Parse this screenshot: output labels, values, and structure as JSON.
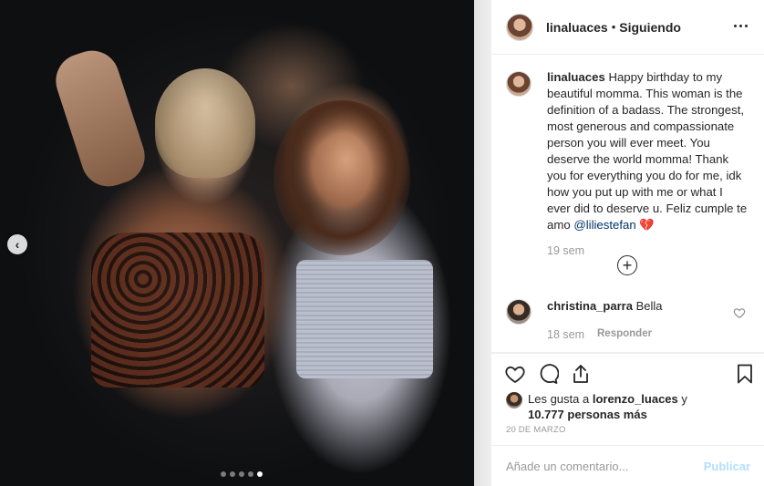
{
  "post": {
    "author": "linaluaces",
    "follow_status": "Siguiendo",
    "separator": "•",
    "caption_user": "linaluaces",
    "caption_text": "Happy birthday to my beautiful momma. This woman is the definition of a badass. The strongest, most generous and compassionate person you will ever meet. You deserve the world momma! Thank you for everything you do for me, idk how you put up with me or what I ever did to deserve u. Feliz cumple te amo ",
    "caption_mention": "@liliestefan",
    "caption_emoji": "💔",
    "caption_time": "19 sem",
    "load_more_symbol": "+"
  },
  "comment": {
    "user": "christina_parra",
    "text": "Bella",
    "time": "18 sem",
    "reply_label": "Responder"
  },
  "likes": {
    "prefix": "Les gusta a",
    "user": "lorenzo_luaces",
    "middle": "y",
    "count": "10.777 personas más"
  },
  "date": "20 DE MARZO",
  "comment_input": {
    "placeholder": "Añade un comentario...",
    "publish_label": "Publicar"
  },
  "carousel": {
    "total_slides": 5,
    "active_index": 4,
    "prev_symbol": "‹"
  },
  "colors": {
    "text": "#262626",
    "muted": "#999999",
    "mention": "#003569",
    "publish_disabled": "#b2dffc",
    "border": "#efefef"
  },
  "icons": [
    "more-options-icon",
    "heart-icon",
    "comment-icon",
    "share-icon",
    "bookmark-icon",
    "add-circle-icon",
    "small-heart-icon",
    "chevron-left-icon"
  ]
}
